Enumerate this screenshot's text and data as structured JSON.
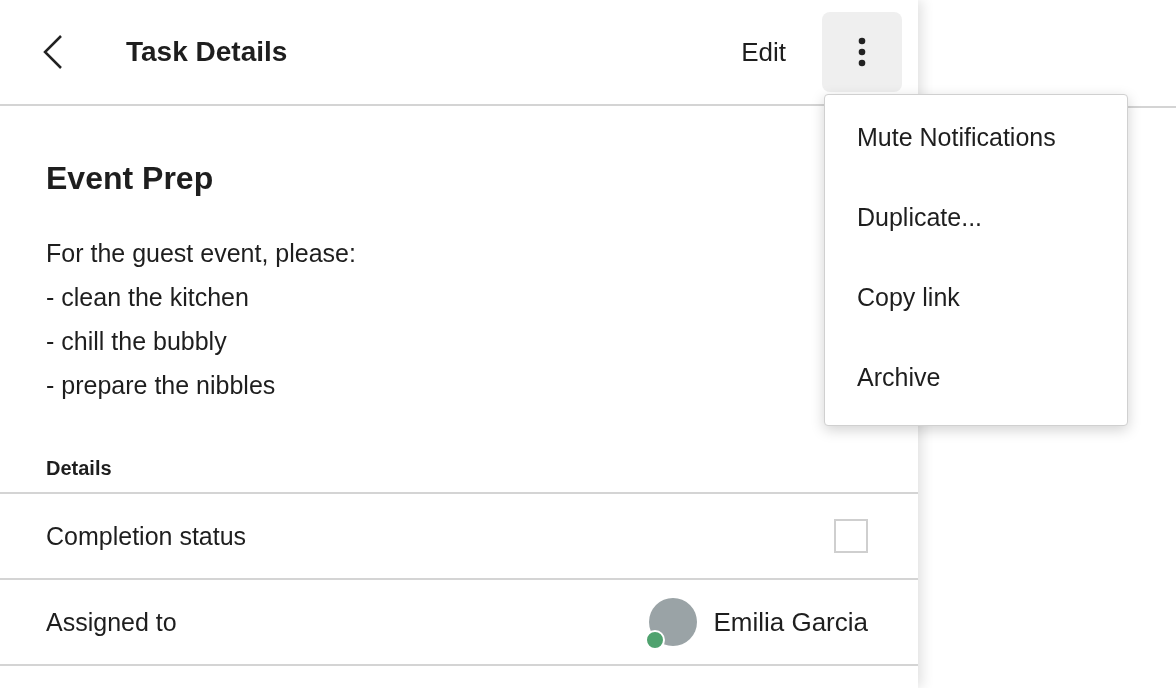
{
  "header": {
    "title": "Task Details",
    "edit_label": "Edit",
    "more_menu_open": true
  },
  "menu": {
    "items": [
      {
        "label": "Mute Notifications"
      },
      {
        "label": "Duplicate..."
      },
      {
        "label": "Copy link"
      },
      {
        "label": "Archive"
      }
    ]
  },
  "task": {
    "title": "Event Prep",
    "description": "For the guest event, please:\n- clean the kitchen\n- chill the bubbly\n- prepare the nibbles"
  },
  "details": {
    "heading": "Details",
    "rows": [
      {
        "kind": "checkbox",
        "label": "Completion status",
        "checked": false
      },
      {
        "kind": "person",
        "label": "Assigned to",
        "name": "Emilia Garcia",
        "online": true
      }
    ]
  }
}
